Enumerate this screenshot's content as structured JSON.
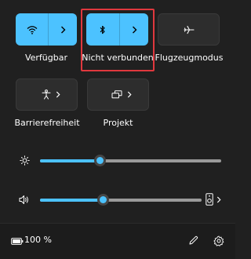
{
  "accent_color": "#4cc2ff",
  "highlight_color": "#e0383e",
  "tiles": [
    {
      "label": "Verfügbar",
      "icon": "wifi-icon",
      "state": "on",
      "has_chevron": true
    },
    {
      "label": "Nicht verbunden",
      "icon": "bluetooth-icon",
      "state": "on",
      "has_chevron": true
    },
    {
      "label": "Flugzeugmodus",
      "icon": "airplane-icon",
      "state": "off",
      "has_chevron": false
    },
    {
      "label": "Barrierefreiheit",
      "icon": "accessibility-icon",
      "state": "off",
      "has_chevron": true
    },
    {
      "label": "Projekt",
      "icon": "project-display-icon",
      "state": "off",
      "has_chevron": true
    }
  ],
  "brightness": {
    "icon": "brightness-icon",
    "level": 0.33
  },
  "volume": {
    "icon": "speaker-icon",
    "level": 0.39,
    "output_icon": "audio-output-device-icon",
    "output_chevron": ">"
  },
  "battery": {
    "icon": "battery-icon",
    "percent_text": "100 %"
  },
  "footer": {
    "edit_icon": "pencil-edit-icon",
    "settings_icon": "gear-icon"
  }
}
